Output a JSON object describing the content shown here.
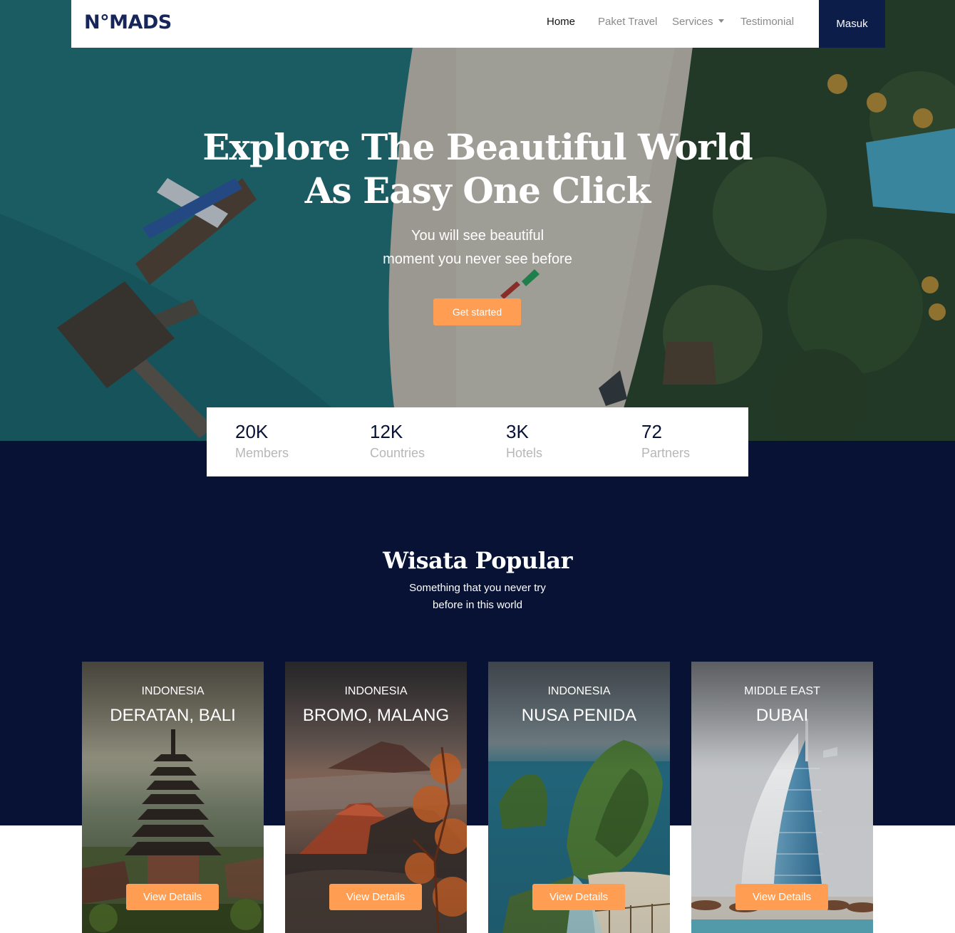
{
  "brand": {
    "logo_text": "N°MADS"
  },
  "nav": {
    "items": [
      {
        "label": "Home",
        "active": true
      },
      {
        "label": "Paket Travel",
        "active": false
      },
      {
        "label": "Services",
        "active": false,
        "dropdown": true
      },
      {
        "label": "Testimonial",
        "active": false
      }
    ],
    "login_label": "Masuk"
  },
  "hero": {
    "title_line1": "Explore The Beautiful World",
    "title_line2": "As Easy One Click",
    "subtitle_line1": "You will see beautiful",
    "subtitle_line2": "moment you never see before",
    "cta_label": "Get started"
  },
  "stats": [
    {
      "value": "20K",
      "label": "Members"
    },
    {
      "value": "12K",
      "label": "Countries"
    },
    {
      "value": "3K",
      "label": "Hotels"
    },
    {
      "value": "72",
      "label": "Partners"
    }
  ],
  "popular": {
    "title": "Wisata Popular",
    "subtitle_line1": "Something that you never try",
    "subtitle_line2": "before in this world",
    "button_label": "View Details",
    "cards": [
      {
        "country": "INDONESIA",
        "name": "DERATAN, BALI",
        "scene": "pagoda"
      },
      {
        "country": "INDONESIA",
        "name": "BROMO, MALANG",
        "scene": "volcano"
      },
      {
        "country": "INDONESIA",
        "name": "NUSA PENIDA",
        "scene": "cliff"
      },
      {
        "country": "MIDDLE EAST",
        "name": "DUBAI",
        "scene": "tower"
      }
    ]
  },
  "colors": {
    "navy": "#071235",
    "brand_navy": "#0d1d4a",
    "accent_orange": "#ff9e53",
    "muted_text": "#b7b7b7"
  }
}
